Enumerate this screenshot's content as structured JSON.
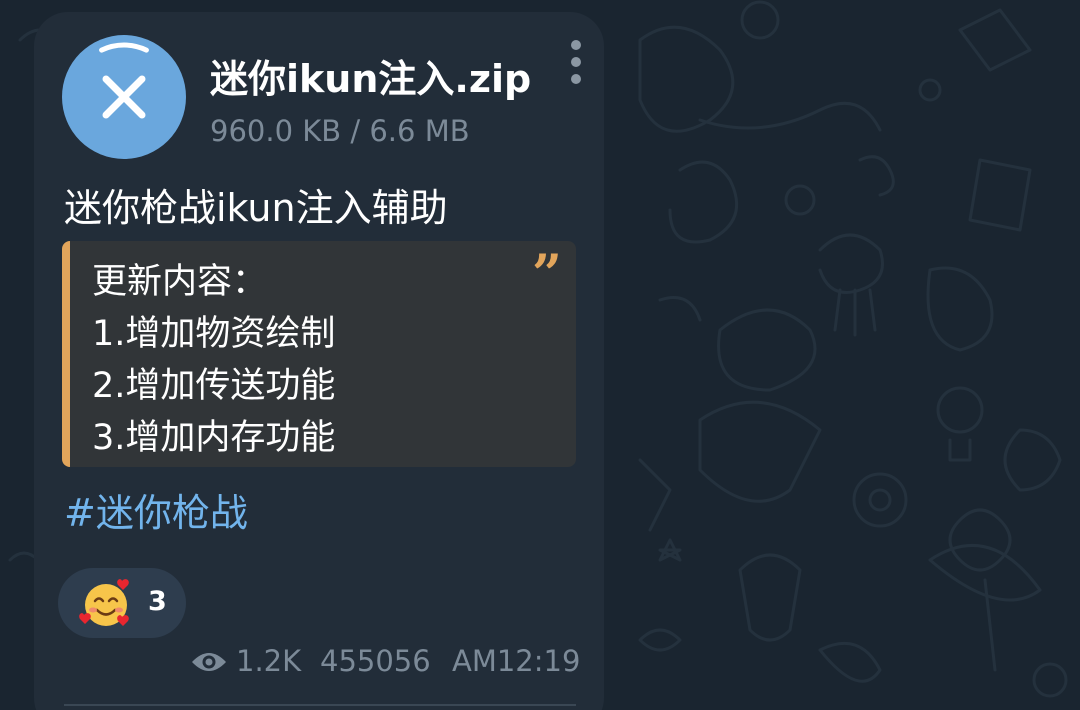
{
  "file": {
    "name": "迷你ikun注入.zip",
    "size": "960.0 KB / 6.6 MB",
    "download_progress": 0.142,
    "cancel_icon": "close-icon"
  },
  "message": {
    "caption": "迷你枪战ikun注入辅助",
    "quote": {
      "lines": [
        "更新内容：",
        "1.增加物资绘制",
        "2.增加传送功能",
        "3.增加内存功能"
      ],
      "quote_icon": "quote-mark-icon",
      "accent_color": "#e2a55b"
    },
    "hashtag": "#迷你枪战",
    "reaction": {
      "emoji": "smiling-face-with-hearts",
      "count": "3"
    },
    "footer": {
      "views_icon": "eye-icon",
      "views": "1.2K",
      "author": "455056",
      "time": "AM12:19"
    }
  },
  "colors": {
    "background": "#1a2530",
    "bubble": "#222d39",
    "accent_blue": "#6aa7dd",
    "link": "#72b4ec",
    "muted_text": "#7c8a98"
  }
}
